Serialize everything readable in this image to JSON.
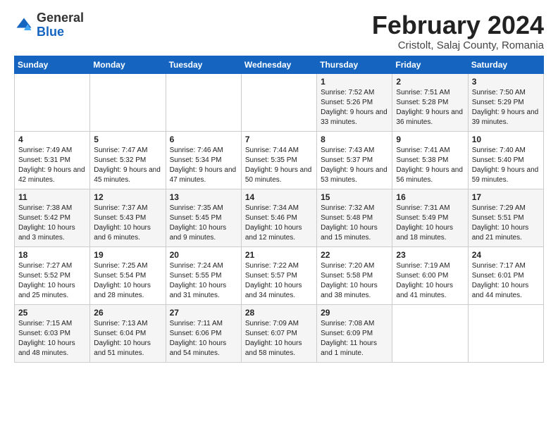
{
  "logo": {
    "general": "General",
    "blue": "Blue"
  },
  "header": {
    "title": "February 2024",
    "subtitle": "Cristolt, Salaj County, Romania"
  },
  "weekdays": [
    "Sunday",
    "Monday",
    "Tuesday",
    "Wednesday",
    "Thursday",
    "Friday",
    "Saturday"
  ],
  "weeks": [
    [
      {
        "day": "",
        "info": ""
      },
      {
        "day": "",
        "info": ""
      },
      {
        "day": "",
        "info": ""
      },
      {
        "day": "",
        "info": ""
      },
      {
        "day": "1",
        "info": "Sunrise: 7:52 AM\nSunset: 5:26 PM\nDaylight: 9 hours\nand 33 minutes."
      },
      {
        "day": "2",
        "info": "Sunrise: 7:51 AM\nSunset: 5:28 PM\nDaylight: 9 hours\nand 36 minutes."
      },
      {
        "day": "3",
        "info": "Sunrise: 7:50 AM\nSunset: 5:29 PM\nDaylight: 9 hours\nand 39 minutes."
      }
    ],
    [
      {
        "day": "4",
        "info": "Sunrise: 7:49 AM\nSunset: 5:31 PM\nDaylight: 9 hours\nand 42 minutes."
      },
      {
        "day": "5",
        "info": "Sunrise: 7:47 AM\nSunset: 5:32 PM\nDaylight: 9 hours\nand 45 minutes."
      },
      {
        "day": "6",
        "info": "Sunrise: 7:46 AM\nSunset: 5:34 PM\nDaylight: 9 hours\nand 47 minutes."
      },
      {
        "day": "7",
        "info": "Sunrise: 7:44 AM\nSunset: 5:35 PM\nDaylight: 9 hours\nand 50 minutes."
      },
      {
        "day": "8",
        "info": "Sunrise: 7:43 AM\nSunset: 5:37 PM\nDaylight: 9 hours\nand 53 minutes."
      },
      {
        "day": "9",
        "info": "Sunrise: 7:41 AM\nSunset: 5:38 PM\nDaylight: 9 hours\nand 56 minutes."
      },
      {
        "day": "10",
        "info": "Sunrise: 7:40 AM\nSunset: 5:40 PM\nDaylight: 9 hours\nand 59 minutes."
      }
    ],
    [
      {
        "day": "11",
        "info": "Sunrise: 7:38 AM\nSunset: 5:42 PM\nDaylight: 10 hours\nand 3 minutes."
      },
      {
        "day": "12",
        "info": "Sunrise: 7:37 AM\nSunset: 5:43 PM\nDaylight: 10 hours\nand 6 minutes."
      },
      {
        "day": "13",
        "info": "Sunrise: 7:35 AM\nSunset: 5:45 PM\nDaylight: 10 hours\nand 9 minutes."
      },
      {
        "day": "14",
        "info": "Sunrise: 7:34 AM\nSunset: 5:46 PM\nDaylight: 10 hours\nand 12 minutes."
      },
      {
        "day": "15",
        "info": "Sunrise: 7:32 AM\nSunset: 5:48 PM\nDaylight: 10 hours\nand 15 minutes."
      },
      {
        "day": "16",
        "info": "Sunrise: 7:31 AM\nSunset: 5:49 PM\nDaylight: 10 hours\nand 18 minutes."
      },
      {
        "day": "17",
        "info": "Sunrise: 7:29 AM\nSunset: 5:51 PM\nDaylight: 10 hours\nand 21 minutes."
      }
    ],
    [
      {
        "day": "18",
        "info": "Sunrise: 7:27 AM\nSunset: 5:52 PM\nDaylight: 10 hours\nand 25 minutes."
      },
      {
        "day": "19",
        "info": "Sunrise: 7:25 AM\nSunset: 5:54 PM\nDaylight: 10 hours\nand 28 minutes."
      },
      {
        "day": "20",
        "info": "Sunrise: 7:24 AM\nSunset: 5:55 PM\nDaylight: 10 hours\nand 31 minutes."
      },
      {
        "day": "21",
        "info": "Sunrise: 7:22 AM\nSunset: 5:57 PM\nDaylight: 10 hours\nand 34 minutes."
      },
      {
        "day": "22",
        "info": "Sunrise: 7:20 AM\nSunset: 5:58 PM\nDaylight: 10 hours\nand 38 minutes."
      },
      {
        "day": "23",
        "info": "Sunrise: 7:19 AM\nSunset: 6:00 PM\nDaylight: 10 hours\nand 41 minutes."
      },
      {
        "day": "24",
        "info": "Sunrise: 7:17 AM\nSunset: 6:01 PM\nDaylight: 10 hours\nand 44 minutes."
      }
    ],
    [
      {
        "day": "25",
        "info": "Sunrise: 7:15 AM\nSunset: 6:03 PM\nDaylight: 10 hours\nand 48 minutes."
      },
      {
        "day": "26",
        "info": "Sunrise: 7:13 AM\nSunset: 6:04 PM\nDaylight: 10 hours\nand 51 minutes."
      },
      {
        "day": "27",
        "info": "Sunrise: 7:11 AM\nSunset: 6:06 PM\nDaylight: 10 hours\nand 54 minutes."
      },
      {
        "day": "28",
        "info": "Sunrise: 7:09 AM\nSunset: 6:07 PM\nDaylight: 10 hours\nand 58 minutes."
      },
      {
        "day": "29",
        "info": "Sunrise: 7:08 AM\nSunset: 6:09 PM\nDaylight: 11 hours\nand 1 minute."
      },
      {
        "day": "",
        "info": ""
      },
      {
        "day": "",
        "info": ""
      }
    ]
  ]
}
